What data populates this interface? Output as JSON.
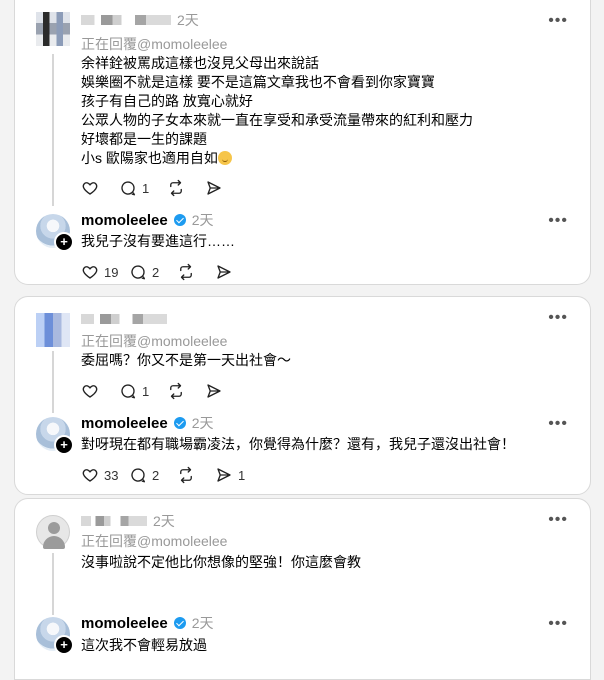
{
  "threads": [
    {
      "comment": {
        "time": "2天",
        "replying": "正在回覆@momoleelee",
        "lines": [
          "余祥銓被罵成這樣也沒見父母出來說話",
          "娛樂圈不就是這樣 要不是這篇文章我也不會看到你家寶寶",
          "孩子有自己的路 放寬心就好",
          "公眾人物的子女本來就一直在享受和承受流量帶來的紅利和壓力",
          "好壞都是一生的課題",
          "小s 歐陽家也適用自如"
        ],
        "likes": "",
        "replies": "1",
        "reposts": ""
      },
      "reply": {
        "username": "momoleelee",
        "time": "2天",
        "text": "我兒子沒有要進這行……",
        "likes": "19",
        "replies": "2",
        "reposts": ""
      }
    },
    {
      "comment": {
        "time": "",
        "replying": "正在回覆@momoleelee",
        "lines": [
          "委屈嗎？你又不是第一天出社會～"
        ],
        "replies": "1"
      },
      "reply": {
        "username": "momoleelee",
        "time": "2天",
        "text": "對呀現在都有職場霸凌法，你覺得為什麼？還有，我兒子還沒出社會！",
        "likes": "33",
        "replies": "2",
        "shares": "1"
      }
    },
    {
      "comment": {
        "time": "2天",
        "replying": "正在回覆@momoleelee",
        "lines": [
          "沒事啦說不定他比你想像的堅強！你這麼會教"
        ]
      },
      "reply": {
        "username": "momoleelee",
        "time": "2天",
        "text": "這次我不會輕易放過"
      }
    }
  ],
  "icons": {
    "like": "heart-icon",
    "reply": "comment-icon",
    "repost": "repost-icon",
    "share": "send-icon",
    "more": "more-icon"
  },
  "colors": {
    "verified": "#1d9bf0",
    "muted": "#999999"
  }
}
